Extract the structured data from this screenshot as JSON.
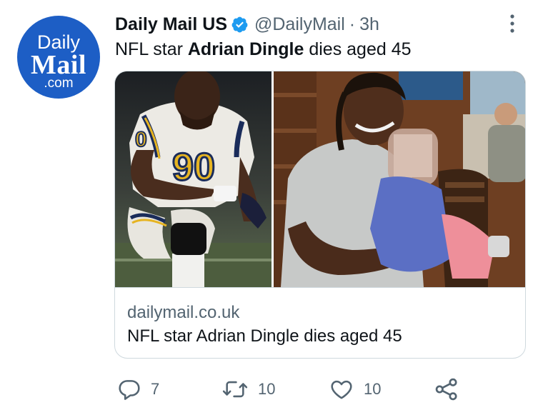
{
  "account": {
    "avatar_lines": [
      "Daily",
      "Mail",
      ".com"
    ],
    "display_name": "Daily Mail US",
    "handle": "@DailyMail",
    "separator": "·",
    "timestamp": "3h",
    "verified": true
  },
  "tweet": {
    "text_before": "NFL star ",
    "text_bold": "Adrian Dingle",
    "text_after": " dies aged 45"
  },
  "card": {
    "domain": "dailymail.co.uk",
    "title": "NFL star Adrian Dingle dies aged 45",
    "images": [
      {
        "description": "Football player in white #90 jersey kneeling on field",
        "jersey_number": "90"
      },
      {
        "description": "Smiling man in grey t-shirt holding a child in a restaurant"
      }
    ]
  },
  "actions": {
    "reply_count": "7",
    "retweet_count": "10",
    "like_count": "10"
  },
  "colors": {
    "brand_blue": "#1d5ec5",
    "verified_blue": "#1d9bf0",
    "secondary_text": "#536471",
    "border": "#cfd9de"
  },
  "icons": [
    "verified-badge-icon",
    "more-options-icon",
    "reply-icon",
    "retweet-icon",
    "like-icon",
    "share-icon"
  ]
}
